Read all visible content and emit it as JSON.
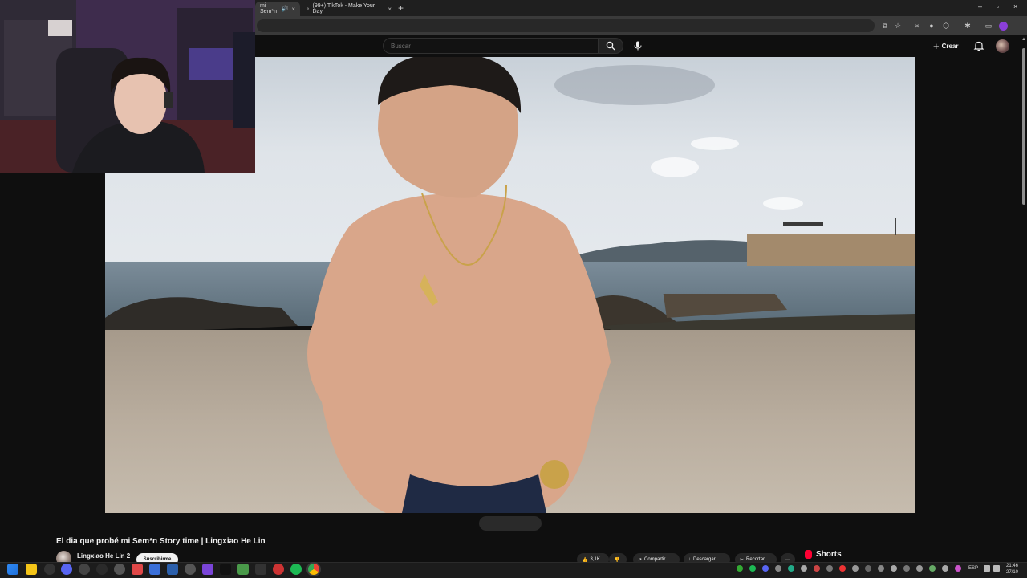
{
  "browser": {
    "tabs": [
      {
        "label": "mi Sem*n",
        "active": true
      },
      {
        "label": "(99+) TikTok - Make Your Day",
        "active": false
      }
    ],
    "new_tab_icon": "plus-icon",
    "window_controls": [
      "minimize-icon",
      "restore-icon",
      "close-icon"
    ]
  },
  "youtube": {
    "search": {
      "placeholder": "Buscar"
    },
    "create_label": "Crear",
    "icons": [
      "search-icon",
      "mic-icon",
      "plus-icon",
      "bell-icon",
      "avatar"
    ]
  },
  "video": {
    "title": "El dia que probé mi Sem*n Story time | Lingxiao He Lin",
    "channel": "Lingxiao He Lin 2",
    "subscribe_label": "Suscribirme",
    "actions": [
      {
        "label": "3,1K",
        "icon": "thumbs-up-icon"
      },
      {
        "label": "",
        "icon": "thumbs-down-icon"
      },
      {
        "label": "Compartir",
        "icon": "share-icon"
      },
      {
        "label": "Descargar",
        "icon": "download-icon"
      },
      {
        "label": "Recortar",
        "icon": "clip-icon"
      },
      {
        "label": "",
        "icon": "more-icon"
      }
    ],
    "shorts_label": "Shorts"
  },
  "taskbar": {
    "language": "ESP",
    "time": "21:46",
    "date": "27/10"
  },
  "colors": {
    "background": "#0f0f0f",
    "chrome_toolbar": "#3a3a3a",
    "shorts_red": "#ff0033"
  }
}
